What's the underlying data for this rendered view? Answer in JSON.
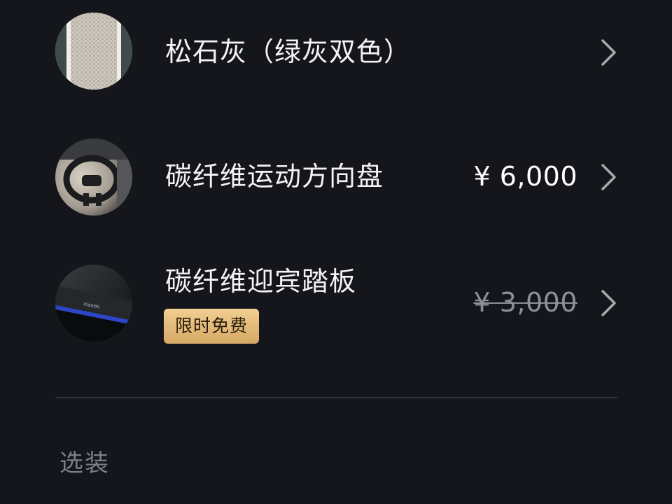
{
  "options": [
    {
      "thumb_icon": "slate-gray-interior-swatch",
      "title": "松石灰（绿灰双色）",
      "price": ""
    },
    {
      "thumb_icon": "steering-wheel-photo",
      "title": "碳纤维运动方向盘",
      "price": "¥ 6,000"
    },
    {
      "thumb_icon": "door-sill-photo",
      "title": "碳纤维迎宾踏板",
      "price": "¥ 3,000",
      "badge": "限时免费"
    }
  ],
  "section": {
    "label": "选装"
  },
  "colors": {
    "background": "#14161b",
    "divider": "#31343b",
    "badge_gold": "#e6bd7c",
    "strike_price": "#8e9096",
    "chevron": "#a7a9ae"
  }
}
